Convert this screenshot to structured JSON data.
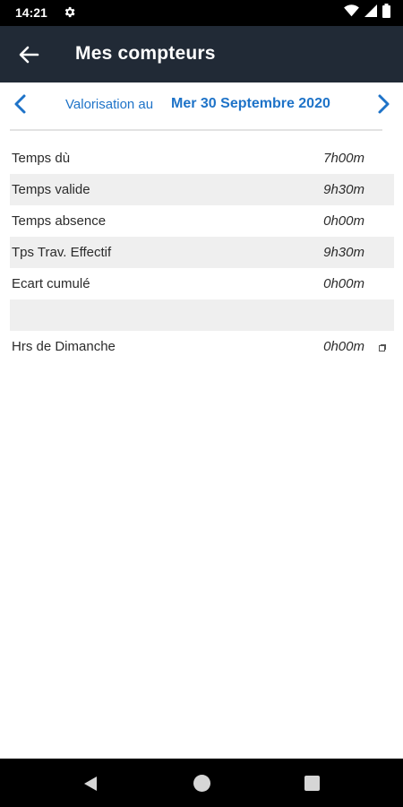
{
  "status_bar": {
    "time": "14:21",
    "icons": [
      "gear-icon",
      "wifi-icon",
      "signal-icon",
      "battery-icon"
    ]
  },
  "app_bar": {
    "title": "Mes compteurs",
    "back_icon": "arrow-left-icon",
    "background": "#212a36"
  },
  "date_nav": {
    "label": "Valorisation au",
    "date": "Mer 30 Septembre 2020",
    "accent": "#1e73c8"
  },
  "counters": [
    {
      "label": "Temps dù",
      "value": "7h00m"
    },
    {
      "label": "Temps valide",
      "value": "9h30m"
    },
    {
      "label": "Temps absence",
      "value": "0h00m"
    },
    {
      "label": "Tps Trav. Effectif",
      "value": "9h30m"
    },
    {
      "label": "Ecart cumulé",
      "value": "0h00m"
    },
    {
      "label": "",
      "value": ""
    },
    {
      "label": "Hrs de Dimanche",
      "value": "0h00m",
      "icon": "note-icon"
    }
  ],
  "system_nav": {
    "icons": [
      "back-triangle-icon",
      "home-circle-icon",
      "recents-square-icon"
    ]
  }
}
